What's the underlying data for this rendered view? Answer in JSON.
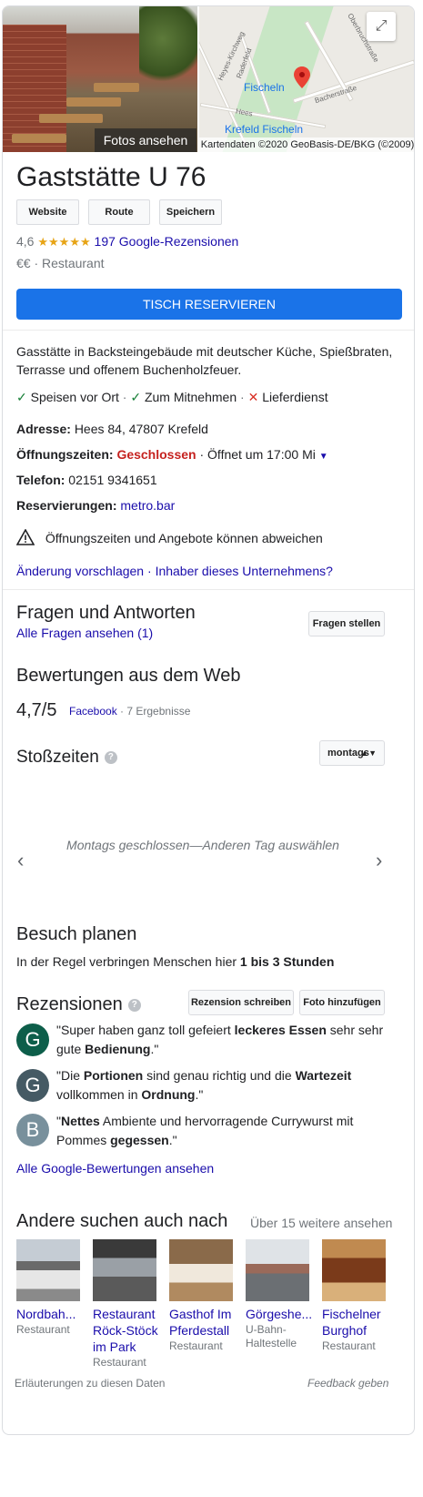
{
  "header": {
    "photo_button": "Fotos ansehen",
    "map_copyright": "Kartendaten ©2020 GeoBasis-DE/BKG (©2009)",
    "map_labels": {
      "fischeln": "Fischeln",
      "krefeld_fischeln": "Krefeld Fischeln",
      "hees": "Hees",
      "heyes_kirchweg": "Heyes-Kirchweg",
      "raderfeld": "Raderfeld",
      "bacherstrasse": "Bacherstraße",
      "oberbruchstrasse": "Oberbruchstraße"
    }
  },
  "business": {
    "name": "Gaststätte U 76",
    "buttons": {
      "website": "Website",
      "route": "Route",
      "save": "Speichern"
    },
    "rating": "4,6",
    "rating_value": 4.6,
    "reviews_link": "197 Google-Rezensionen",
    "price": "€€",
    "category": "Restaurant",
    "reserve_button": "TISCH RESERVIEREN",
    "description": "Gasstätte in Backsteingebäude mit deutscher Küche, Spießbraten, Terrasse und offenem Buchenholzfeuer.",
    "services": [
      {
        "label": "Speisen vor Ort",
        "available": true
      },
      {
        "label": "Zum Mitnehmen",
        "available": true
      },
      {
        "label": "Lieferdienst",
        "available": false
      }
    ],
    "address_label": "Adresse:",
    "address": "Hees 84, 47807 Krefeld",
    "hours_label": "Öffnungszeiten:",
    "hours_status": "Geschlossen",
    "hours_next": "· Öffnet um 17:00 Mi",
    "phone_label": "Telefon:",
    "phone": "02151 9341651",
    "reservations_label": "Reservierungen:",
    "reservations_link": "metro.bar",
    "warning": "Öffnungszeiten und Angebote können abweichen",
    "suggest_link": "Änderung vorschlagen",
    "owner_link": "Inhaber dieses Unternehmens?"
  },
  "qa": {
    "title": "Fragen und Antworten",
    "all_link": "Alle Fragen ansehen (1)",
    "ask_button": "Fragen stellen"
  },
  "web_reviews": {
    "title": "Bewertungen aus dem Web",
    "score": "4,7/5",
    "source": "Facebook",
    "count": "· 7 Ergebnisse"
  },
  "popular_times": {
    "title": "Stoßzeiten",
    "day_select": "montags",
    "closed_message": "Montags geschlossen—Anderen Tag auswählen"
  },
  "plan_visit": {
    "title": "Besuch planen",
    "text_prefix": "In der Regel verbringen Menschen hier ",
    "duration": "1 bis 3 Stunden"
  },
  "reviews": {
    "title": "Rezensionen",
    "write_button": "Rezension schreiben",
    "photo_button": "Foto hinzufügen",
    "items": [
      {
        "initial": "G",
        "color": "#0d5e4a",
        "parts": [
          "\"Super haben ganz toll gefeiert ",
          "leckeres Essen",
          " sehr sehr gute ",
          "Bedienung",
          ".\""
        ]
      },
      {
        "initial": "G",
        "color": "#455a64",
        "parts": [
          "\"Die ",
          "Portionen",
          " sind genau richtig und die ",
          "Wartezeit",
          " vollkommen in ",
          "Ordnung",
          ".\""
        ]
      },
      {
        "initial": "B",
        "color": "#78909c",
        "parts": [
          "\"",
          "Nettes",
          " Ambiente und hervorragende Currywurst mit Pommes ",
          "gegessen",
          ".\""
        ]
      }
    ],
    "all_link": "Alle Google-Bewertungen ansehen"
  },
  "also_searched": {
    "title": "Andere suchen auch nach",
    "more_link": "Über 15 weitere ansehen",
    "items": [
      {
        "name": "Nordbah...",
        "type": "Restaurant"
      },
      {
        "name": "Restaurant Röck-Stöck im Park",
        "type": "Restaurant"
      },
      {
        "name": "Gasthof Im Pferdestall",
        "type": "Restaurant"
      },
      {
        "name": "Görgeshe...",
        "type": "U-Bahn-Haltestelle"
      },
      {
        "name": "Fischelner Burghof",
        "type": "Restaurant"
      }
    ]
  },
  "footer": {
    "info_link": "Erläuterungen zu diesen Daten",
    "feedback_link": "Feedback geben"
  }
}
